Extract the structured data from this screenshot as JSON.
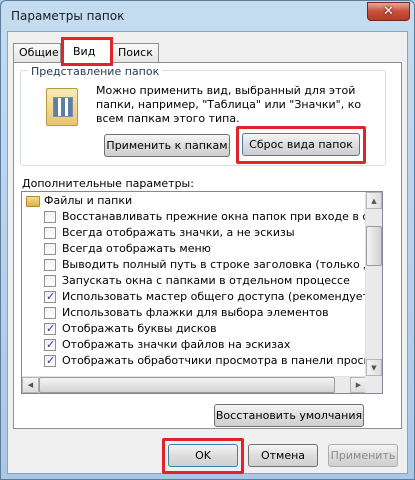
{
  "window": {
    "title": "Параметры папок",
    "close_glyph": "✕"
  },
  "tabs": [
    {
      "label": "Общие",
      "active": false
    },
    {
      "label": "Вид",
      "active": true
    },
    {
      "label": "Поиск",
      "active": false
    }
  ],
  "folder_view": {
    "group_label": "Представление папок",
    "description": "Можно применить вид, выбранный для этой папки, например, \"Таблица\" или \"Значки\", ко всем папкам этого типа.",
    "apply_button": "Применить к папкам",
    "reset_button": "Сброс вида папок"
  },
  "advanced": {
    "label": "Дополнительные параметры:",
    "root_label": "Файлы и папки",
    "items": [
      {
        "label": "Восстанавливать прежние окна папок при входе в систему",
        "checked": false
      },
      {
        "label": "Всегда отображать значки, а не эскизы",
        "checked": false
      },
      {
        "label": "Всегда отображать меню",
        "checked": false
      },
      {
        "label": "Выводить полный путь в строке заголовка (только для классической темы)",
        "checked": false
      },
      {
        "label": "Запускать окна с папками в отдельном процессе",
        "checked": false
      },
      {
        "label": "Использовать мастер общего доступа (рекомендуется)",
        "checked": true
      },
      {
        "label": "Использовать флажки для выбора элементов",
        "checked": false
      },
      {
        "label": "Отображать буквы дисков",
        "checked": true
      },
      {
        "label": "Отображать значки файлов на эскизах",
        "checked": true
      },
      {
        "label": "Отображать обработчики просмотра в панели просмотра",
        "checked": true
      }
    ],
    "restore_button": "Восстановить умолчания"
  },
  "footer": {
    "ok": "OK",
    "cancel": "Отмена",
    "apply": "Применить"
  },
  "colors": {
    "highlight": "#e0242b",
    "window_frame": "#a9c8e6"
  }
}
